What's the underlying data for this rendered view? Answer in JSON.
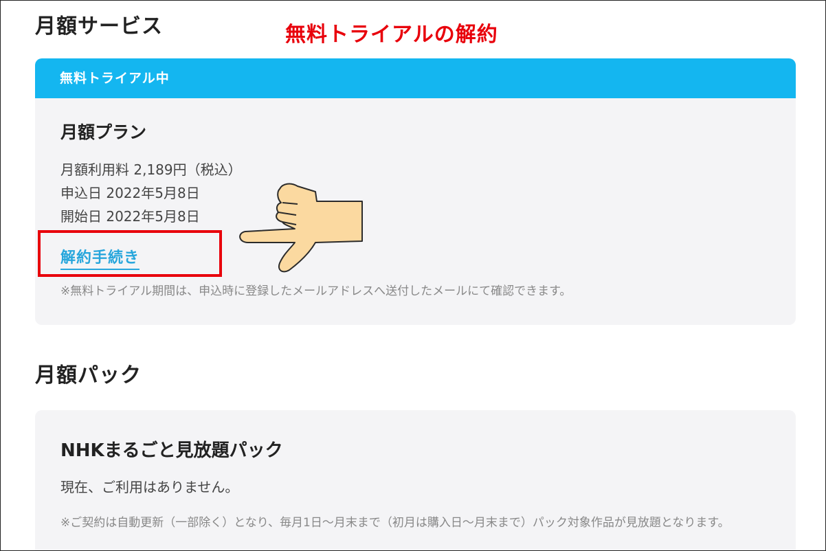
{
  "annotation": {
    "title": "無料トライアルの解約"
  },
  "monthly_service": {
    "section_title": "月額サービス",
    "card": {
      "header": "無料トライアル中",
      "plan_name": "月額プラン",
      "fee_line": "月額利用料 2,189円（税込）",
      "applied_line": "申込日 2022年5月8日",
      "start_line": "開始日 2022年5月8日",
      "cancel_link": "解約手続き",
      "note": "※無料トライアル期間は、申込時に登録したメールアドレスへ送付したメールにて確認できます。"
    }
  },
  "monthly_pack": {
    "section_title": "月額パック",
    "card": {
      "pack_name": "NHKまるごと見放題パック",
      "status": "現在、ご利用はありません。",
      "note": "※ご契約は自動更新（一部除く）となり、毎月1日〜月末まで（初月は購入日〜月末まで）パック対象作品が見放題となります。"
    }
  },
  "colors": {
    "header_blue": "#14b6f0",
    "link_blue": "#27a6dc",
    "annotation_red": "#e8000b",
    "hand_fill": "#fbd9a0"
  },
  "icons": {
    "pointer": "pointing-hand-icon"
  }
}
